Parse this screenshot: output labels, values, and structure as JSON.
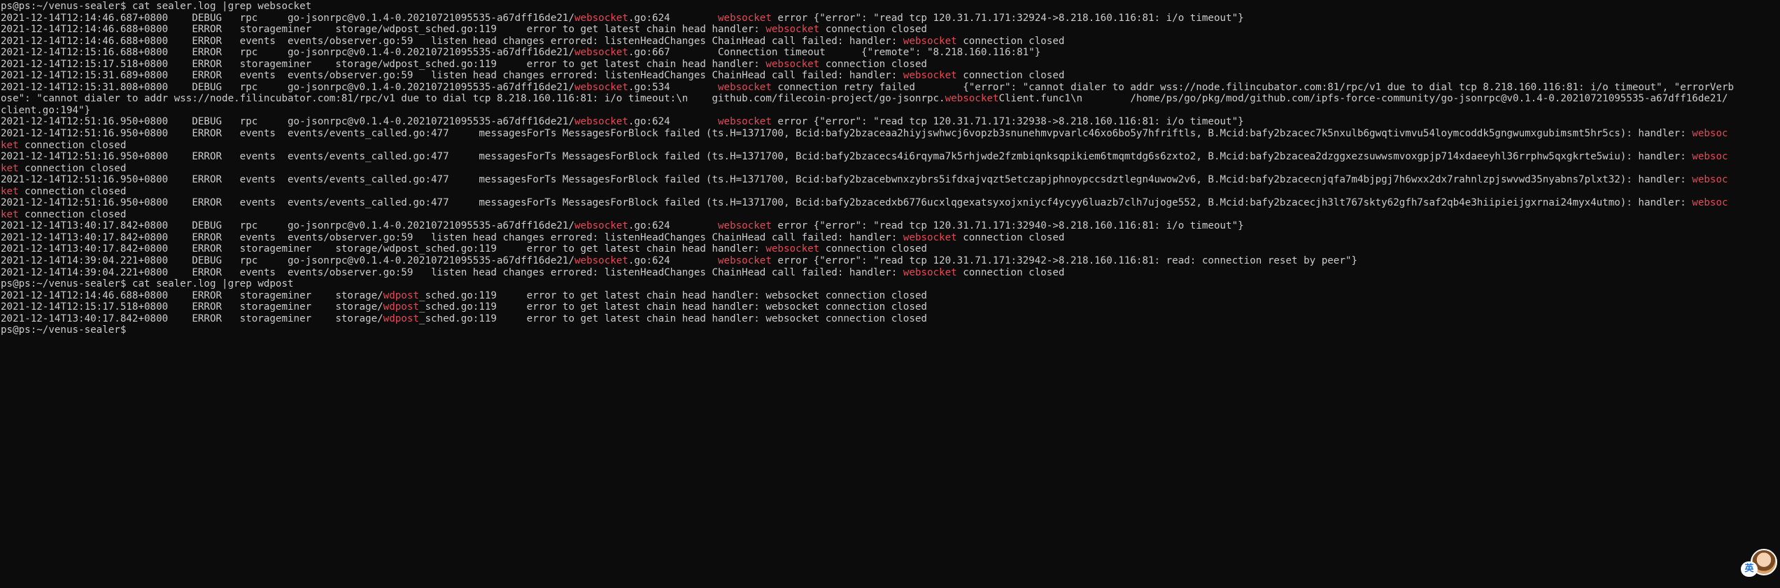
{
  "accent_color": "#e74856",
  "text_color": "#cccccc",
  "background_color": "#0c0c0c",
  "terminal": {
    "lines": [
      [
        {
          "t": "ps@ps:~/venus-sealer$ cat sealer.log |grep websocket"
        }
      ],
      [
        {
          "t": "2021-12-14T12:14:46.687+0800    DEBUG   rpc     go-jsonrpc@v0.1.4-0.20210721095535-a67dff16de21/"
        },
        {
          "t": "websocket",
          "hl": true
        },
        {
          "t": ".go:624        "
        },
        {
          "t": "websocket",
          "hl": true
        },
        {
          "t": " error {\"error\": \"read tcp 120.31.71.171:32924->8.218.160.116:81: i/o timeout\"}"
        }
      ],
      [
        {
          "t": "2021-12-14T12:14:46.688+0800    ERROR   storageminer    storage/wdpost_sched.go:119     error to get latest chain head handler: "
        },
        {
          "t": "websocket",
          "hl": true
        },
        {
          "t": " connection closed"
        }
      ],
      [
        {
          "t": "2021-12-14T12:14:46.688+0800    ERROR   events  events/observer.go:59   listen head changes errored: listenHeadChanges ChainHead call failed: handler: "
        },
        {
          "t": "websocket",
          "hl": true
        },
        {
          "t": " connection closed"
        }
      ],
      [
        {
          "t": "2021-12-14T12:15:16.688+0800    ERROR   rpc     go-jsonrpc@v0.1.4-0.20210721095535-a67dff16de21/"
        },
        {
          "t": "websocket",
          "hl": true
        },
        {
          "t": ".go:667        Connection timeout      {\"remote\": \"8.218.160.116:81\"}"
        }
      ],
      [
        {
          "t": "2021-12-14T12:15:17.518+0800    ERROR   storageminer    storage/wdpost_sched.go:119     error to get latest chain head handler: "
        },
        {
          "t": "websocket",
          "hl": true
        },
        {
          "t": " connection closed"
        }
      ],
      [
        {
          "t": "2021-12-14T12:15:31.689+0800    ERROR   events  events/observer.go:59   listen head changes errored: listenHeadChanges ChainHead call failed: handler: "
        },
        {
          "t": "websocket",
          "hl": true
        },
        {
          "t": " connection closed"
        }
      ],
      [
        {
          "t": "2021-12-14T12:15:31.808+0800    DEBUG   rpc     go-jsonrpc@v0.1.4-0.20210721095535-a67dff16de21/"
        },
        {
          "t": "websocket",
          "hl": true
        },
        {
          "t": ".go:534        "
        },
        {
          "t": "websocket",
          "hl": true
        },
        {
          "t": " connection retry failed        {\"error\": \"cannot dialer to addr wss://node.filincubator.com:81/rpc/v1 due to dial tcp 8.218.160.116:81: i/o timeout\", \"errorVerb"
        }
      ],
      [
        {
          "t": "ose\": \"cannot dialer to addr wss://node.filincubator.com:81/rpc/v1 due to dial tcp 8.218.160.116:81: i/o timeout:\\n    github.com/filecoin-project/go-jsonrpc."
        },
        {
          "t": "websocket",
          "hl": true
        },
        {
          "t": "Client.func1\\n        /home/ps/go/pkg/mod/github.com/ipfs-force-community/go-jsonrpc@v0.1.4-0.20210721095535-a67dff16de21/"
        }
      ],
      [
        {
          "t": "client.go:194\"}"
        }
      ],
      [
        {
          "t": "2021-12-14T12:51:16.950+0800    DEBUG   rpc     go-jsonrpc@v0.1.4-0.20210721095535-a67dff16de21/"
        },
        {
          "t": "websocket",
          "hl": true
        },
        {
          "t": ".go:624        "
        },
        {
          "t": "websocket",
          "hl": true
        },
        {
          "t": " error {\"error\": \"read tcp 120.31.71.171:32938->8.218.160.116:81: i/o timeout\"}"
        }
      ],
      [
        {
          "t": "2021-12-14T12:51:16.950+0800    ERROR   events  events/events_called.go:477     messagesForTs MessagesForBlock failed (ts.H=1371700, Bcid:bafy2bzaceaa2hiyjswhwcj6vopzb3snunehmvpvarlc46xo6bo5y7hfriftls, B.Mcid:bafy2bzacec7k5nxulb6gwqtivmvu54loymcoddk5gngwumxgubimsmt5hr5cs): handler: "
        },
        {
          "t": "websoc",
          "hl": true
        }
      ],
      [
        {
          "t": "ket",
          "hl": true
        },
        {
          "t": " connection closed"
        }
      ],
      [
        {
          "t": "2021-12-14T12:51:16.950+0800    ERROR   events  events/events_called.go:477     messagesForTs MessagesForBlock failed (ts.H=1371700, Bcid:bafy2bzacecs4i6rqyma7k5rhjwde2fzmbiqnksqpikiem6tmqmtdg6s6zxto2, B.Mcid:bafy2bzacea2dzggxezsuwwsmvoxgpjp714xdaeeyhl36rrphw5qxgkrte5wiu): handler: "
        },
        {
          "t": "websoc",
          "hl": true
        }
      ],
      [
        {
          "t": "ket",
          "hl": true
        },
        {
          "t": " connection closed"
        }
      ],
      [
        {
          "t": "2021-12-14T12:51:16.950+0800    ERROR   events  events/events_called.go:477     messagesForTs MessagesForBlock failed (ts.H=1371700, Bcid:bafy2bzacebwnxzybrs5ifdxajvqzt5etczapjphnoypccsdztlegn4uwow2v6, B.Mcid:bafy2bzacecnjqfa7m4bjpgj7h6wxx2dx7rahnlzpjswvwd35nyabns7plxt32): handler: "
        },
        {
          "t": "websoc",
          "hl": true
        }
      ],
      [
        {
          "t": "ket",
          "hl": true
        },
        {
          "t": " connection closed"
        }
      ],
      [
        {
          "t": "2021-12-14T12:51:16.950+0800    ERROR   events  events/events_called.go:477     messagesForTs MessagesForBlock failed (ts.H=1371700, Bcid:bafy2bzacedxb6776ucxlqgexatsyxojxniycf4ycyy6luazb7clh7ujoge552, B.Mcid:bafy2bzacecjh3lt767skty62gfh7saf2qb4e3hiipieijgxrnai24myx4utmo): handler: "
        },
        {
          "t": "websoc",
          "hl": true
        }
      ],
      [
        {
          "t": "ket",
          "hl": true
        },
        {
          "t": " connection closed"
        }
      ],
      [
        {
          "t": "2021-12-14T13:40:17.842+0800    DEBUG   rpc     go-jsonrpc@v0.1.4-0.20210721095535-a67dff16de21/"
        },
        {
          "t": "websocket",
          "hl": true
        },
        {
          "t": ".go:624        "
        },
        {
          "t": "websocket",
          "hl": true
        },
        {
          "t": " error {\"error\": \"read tcp 120.31.71.171:32940->8.218.160.116:81: i/o timeout\"}"
        }
      ],
      [
        {
          "t": "2021-12-14T13:40:17.842+0800    ERROR   events  events/observer.go:59   listen head changes errored: listenHeadChanges ChainHead call failed: handler: "
        },
        {
          "t": "websocket",
          "hl": true
        },
        {
          "t": " connection closed"
        }
      ],
      [
        {
          "t": "2021-12-14T13:40:17.842+0800    ERROR   storageminer    storage/wdpost_sched.go:119     error to get latest chain head handler: "
        },
        {
          "t": "websocket",
          "hl": true
        },
        {
          "t": " connection closed"
        }
      ],
      [
        {
          "t": "2021-12-14T14:39:04.221+0800    DEBUG   rpc     go-jsonrpc@v0.1.4-0.20210721095535-a67dff16de21/"
        },
        {
          "t": "websocket",
          "hl": true
        },
        {
          "t": ".go:624        "
        },
        {
          "t": "websocket",
          "hl": true
        },
        {
          "t": " error {\"error\": \"read tcp 120.31.71.171:32942->8.218.160.116:81: read: connection reset by peer\"}"
        }
      ],
      [
        {
          "t": "2021-12-14T14:39:04.221+0800    ERROR   events  events/observer.go:59   listen head changes errored: listenHeadChanges ChainHead call failed: handler: "
        },
        {
          "t": "websocket",
          "hl": true
        },
        {
          "t": " connection closed"
        }
      ],
      [
        {
          "t": "ps@ps:~/venus-sealer$ cat sealer.log |grep wdpost"
        }
      ],
      [
        {
          "t": "2021-12-14T12:14:46.688+0800    ERROR   storageminer    storage/"
        },
        {
          "t": "wdpost",
          "hl": true
        },
        {
          "t": "_sched.go:119     error to get latest chain head handler: websocket connection closed"
        }
      ],
      [
        {
          "t": "2021-12-14T12:15:17.518+0800    ERROR   storageminer    storage/"
        },
        {
          "t": "wdpost",
          "hl": true
        },
        {
          "t": "_sched.go:119     error to get latest chain head handler: websocket connection closed"
        }
      ],
      [
        {
          "t": "2021-12-14T13:40:17.842+0800    ERROR   storageminer    storage/"
        },
        {
          "t": "wdpost",
          "hl": true
        },
        {
          "t": "_sched.go:119     error to get latest chain head handler: websocket connection closed"
        }
      ],
      [
        {
          "t": "ps@ps:~/venus-sealer$ "
        }
      ]
    ]
  },
  "floating_widget": {
    "badge_label": "英",
    "avatar_icon": "avatar-icon"
  }
}
